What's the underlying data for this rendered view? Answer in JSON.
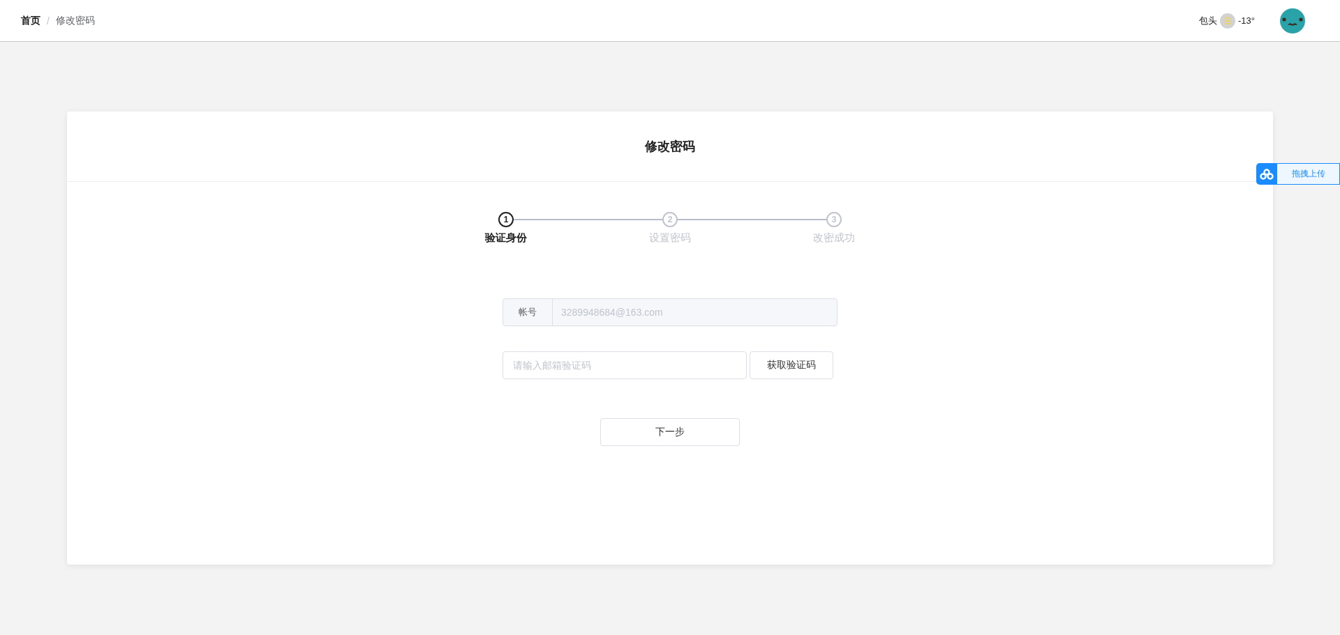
{
  "breadcrumb": [
    {
      "label": "首页",
      "current": false
    },
    {
      "label": "修改密码",
      "current": true
    }
  ],
  "breadcrumb_separator": "/",
  "weather": {
    "city": "包头",
    "temperature": "-13°"
  },
  "card": {
    "title": "修改密码"
  },
  "steps": [
    {
      "number": "1",
      "label": "验证身份",
      "active": true
    },
    {
      "number": "2",
      "label": "设置密码",
      "active": false
    },
    {
      "number": "3",
      "label": "改密成功",
      "active": false
    }
  ],
  "account": {
    "label": "帐号",
    "value": "3289948684@163.com",
    "disabled": true
  },
  "code": {
    "placeholder": "请输入邮箱验证码",
    "button": "获取验证码"
  },
  "next_button": "下一步",
  "upload": {
    "label": "拖拽上传"
  }
}
